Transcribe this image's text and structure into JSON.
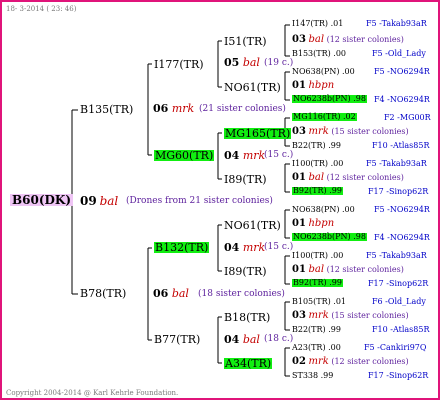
{
  "header": {
    "date": "18-  3-2014 ( 23: 46)"
  },
  "footer": {
    "copyright": "Copyright 2004-2014 @ Karl Kehrle Foundation."
  },
  "root": {
    "id": "B60(DK)",
    "num": "09",
    "type": "bal",
    "note": "(Drones from 21 sister colonies)",
    "father": {
      "id": "B135(TR)",
      "num": "06",
      "type": "mrk",
      "note": "(21 sister colonies)",
      "father": {
        "id": "I177(TR)",
        "num": "05",
        "type": "bal",
        "note": "(19 c.)",
        "father": {
          "id": "I51(TR)",
          "lines": [
            {
              "label": "I147(TR) .01",
              "link": "F5 -Takab93aR"
            },
            {
              "num": "03",
              "type": "bal",
              "note": "(12 sister colonies)"
            },
            {
              "label": "B153(TR) .00",
              "link": "F5 -Old_Lady"
            }
          ]
        },
        "mother": {
          "id": "NO61(TR)",
          "lines": [
            {
              "label": "NO638(PN) .00",
              "link": "F5 -NO6294R"
            },
            {
              "num": "01",
              "type": "hbpn"
            },
            {
              "label": "NO6238b(PN) .98",
              "link": "F4 -NO6294R"
            }
          ]
        }
      },
      "mother": {
        "id": "MG60(TR)",
        "num": "04",
        "type": "mrk",
        "note": "(15 c.)",
        "father": {
          "id": "MG165(TR)",
          "lines": [
            {
              "label": "MG116(TR) .02",
              "link": "F2 -MG00R"
            },
            {
              "num": "03",
              "type": "mrk",
              "note": "(15 sister colonies)"
            },
            {
              "label": "B22(TR) .99",
              "link": "F10 -Atlas85R"
            }
          ]
        },
        "mother": {
          "id": "I89(TR)",
          "lines": [
            {
              "label": "I100(TR) .00",
              "link": "F5 -Takab93aR"
            },
            {
              "num": "01",
              "type": "bal",
              "note": "(12 sister colonies)"
            },
            {
              "label": "B92(TR) .99",
              "link": "F17 -Sinop62R"
            }
          ]
        }
      }
    },
    "mother": {
      "id": "B78(TR)",
      "num": "06",
      "type": "bal",
      "note": "(18 sister colonies)",
      "father": {
        "id": "B132(TR)",
        "num": "04",
        "type": "mrk",
        "note": "(15 c.)",
        "father": {
          "id": "NO61(TR)",
          "lines": [
            {
              "label": "NO638(PN) .00",
              "link": "F5 -NO6294R"
            },
            {
              "num": "01",
              "type": "hbpn"
            },
            {
              "label": "NO6238b(PN) .98",
              "link": "F4 -NO6294R"
            }
          ]
        },
        "mother": {
          "id": "I89(TR)",
          "lines": [
            {
              "label": "I100(TR) .00",
              "link": "F5 -Takab93aR"
            },
            {
              "num": "01",
              "type": "bal",
              "note": "(12 sister colonies)"
            },
            {
              "label": "B92(TR) .99",
              "link": "F17 -Sinop62R"
            }
          ]
        }
      },
      "mother": {
        "id": "B77(TR)",
        "num": "04",
        "type": "bal",
        "note": "(18 c.)",
        "father": {
          "id": "B18(TR)",
          "lines": [
            {
              "label": "B105(TR) .01",
              "link": "F6 -Old_Lady"
            },
            {
              "num": "03",
              "type": "mrk",
              "note": "(15 sister colonies)"
            },
            {
              "label": "B22(TR) .99",
              "link": "F10 -Atlas85R"
            }
          ]
        },
        "mother": {
          "id": "A34(TR)",
          "lines": [
            {
              "label": "A23(TR) .00",
              "link": "F5 -Cankiri97Q"
            },
            {
              "num": "02",
              "type": "mrk",
              "note": "(12 sister colonies)"
            },
            {
              "label": "ST338 .99",
              "link": "F17 -Sinop62R"
            }
          ]
        }
      }
    }
  }
}
